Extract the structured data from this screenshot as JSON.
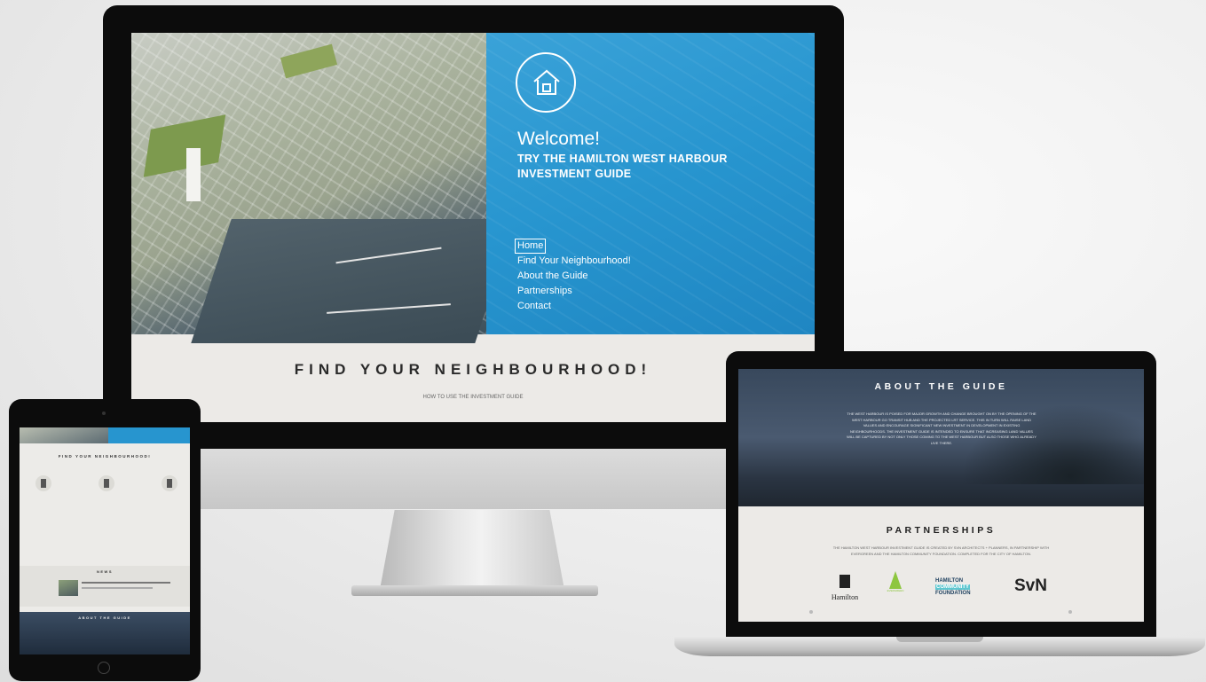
{
  "desktop": {
    "welcome": "Welcome!",
    "tagline": "TRY THE HAMILTON WEST HARBOUR INVESTMENT GUIDE",
    "logo_icon": "house-icon",
    "nav": [
      "Home",
      "Find Your Neighbourhood!",
      "About the Guide",
      "Partnerships",
      "Contact"
    ],
    "active_nav": "Home",
    "section_title": "FIND YOUR NEIGHBOURHOOD!",
    "section_link": "HOW TO USE THE INVESTMENT GUIDE",
    "accent_color": "#2795cf"
  },
  "tablet": {
    "section_title": "FIND YOUR NEIGHBOURHOOD!",
    "news_title": "NEWS",
    "about_title": "ABOUT THE GUIDE"
  },
  "laptop": {
    "about_title": "ABOUT THE GUIDE",
    "about_text": "THE WEST HARBOUR IS POISED FOR MAJOR GROWTH AND CHANGE BROUGHT ON BY THE OPENING OF THE WEST HARBOUR GO TRANSIT HUB AND THE PROJECTED LRT SERVICE. THIS IN TURN WILL RAISE LAND VALUES AND ENCOURAGE SIGNIFICANT NEW INVESTMENT IN DEVELOPMENT IN EXISTING NEIGHBOURHOODS. THE INVESTMENT GUIDE IS INTENDED TO ENSURE THAT INCREASING LAND VALUES WILL BE CAPTURED BY NOT ONLY THOSE COMING TO THE WEST HARBOUR BUT ALSO THOSE WHO ALREADY LIVE THERE.",
    "partners_title": "PARTNERSHIPS",
    "partners_text": "THE HAMILTON WEST HARBOUR INVESTMENT GUIDE IS CREATED BY SVN ARCHITECTS + PLANNERS, IN PARTNERSHIP WITH EVERGREEN AND THE HAMILTON COMMUNITY FOUNDATION. COMPLETED FOR THE CITY OF HAMILTON.",
    "logos": {
      "hamilton": "Hamilton",
      "evergreen": "EVERGREEN",
      "hcf_top": "HAMILTON",
      "hcf_mid": "COMMUNITY",
      "hcf_bottom": "FOUNDATION",
      "svn": "SvN"
    }
  }
}
